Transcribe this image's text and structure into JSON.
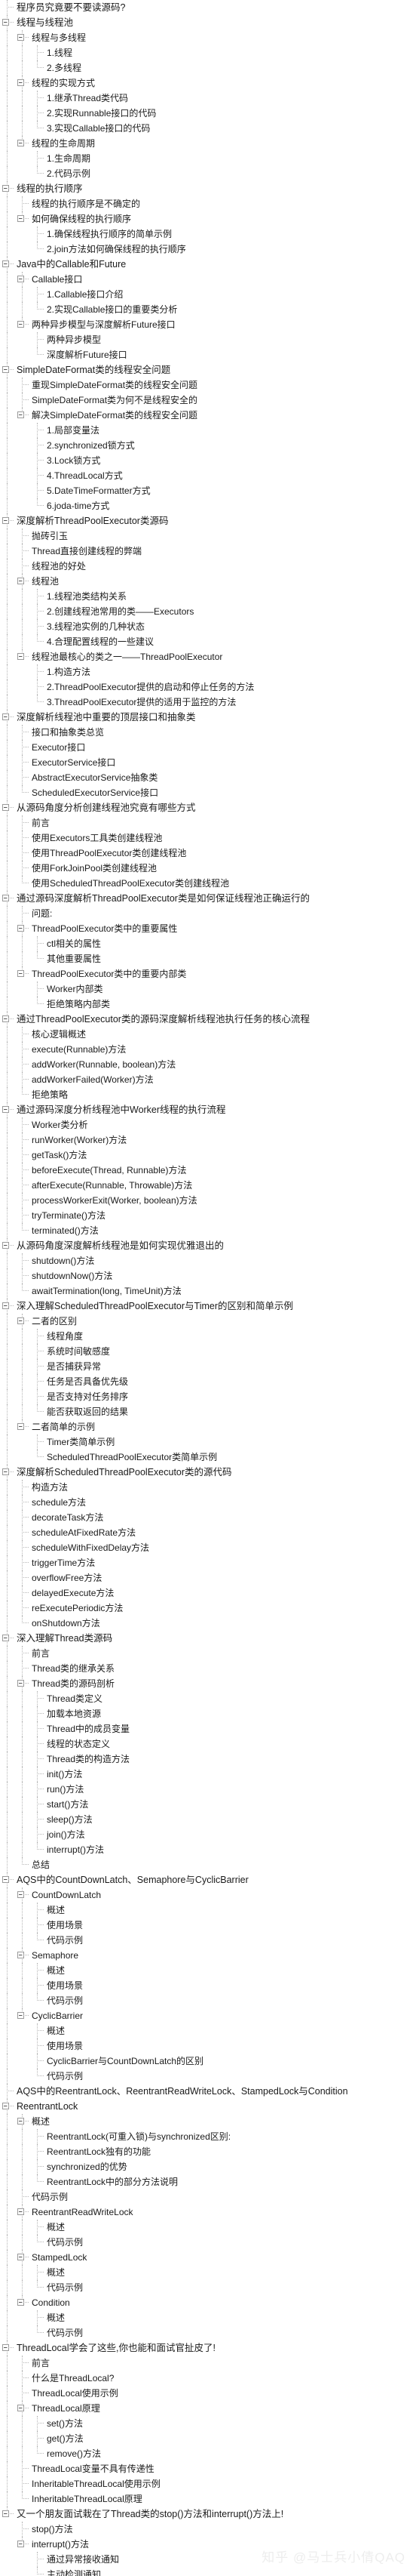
{
  "view": {
    "type": "outline-tree",
    "expander_collapse_glyph": "minus-box",
    "watermark": "知乎 @马士兵小倩QAQ",
    "colors": {
      "text": "#1a1a1a",
      "guide_line": "#b6b6b6",
      "expander_border": "#9a9a9a",
      "background": "#ffffff",
      "watermark": "#ededed"
    }
  },
  "nodes": [
    {
      "level": 0,
      "expandable": false,
      "label": "程序员究竟要不要读源码?"
    },
    {
      "level": 0,
      "expandable": true,
      "label": "线程与线程池"
    },
    {
      "level": 1,
      "expandable": true,
      "label": "线程与多线程"
    },
    {
      "level": 2,
      "expandable": false,
      "label": "1.线程"
    },
    {
      "level": 2,
      "expandable": false,
      "label": "2.多线程"
    },
    {
      "level": 1,
      "expandable": true,
      "label": "线程的实现方式"
    },
    {
      "level": 2,
      "expandable": false,
      "label": "1.继承Thread类代码"
    },
    {
      "level": 2,
      "expandable": false,
      "label": "2.实现Runnable接口的代码"
    },
    {
      "level": 2,
      "expandable": false,
      "label": "3.实现Callable接口的代码"
    },
    {
      "level": 1,
      "expandable": true,
      "label": "线程的生命周期"
    },
    {
      "level": 2,
      "expandable": false,
      "label": "1.生命周期"
    },
    {
      "level": 2,
      "expandable": false,
      "label": "2.代码示例"
    },
    {
      "level": 0,
      "expandable": true,
      "label": "线程的执行顺序"
    },
    {
      "level": 1,
      "expandable": false,
      "label": "线程的执行顺序是不确定的"
    },
    {
      "level": 1,
      "expandable": true,
      "label": "如何确保线程的执行顺序"
    },
    {
      "level": 2,
      "expandable": false,
      "label": "1.确保线程执行顺序的简单示例"
    },
    {
      "level": 2,
      "expandable": false,
      "label": "2.join方法如何确保线程的执行顺序"
    },
    {
      "level": 0,
      "expandable": true,
      "label": "Java中的Callable和Future"
    },
    {
      "level": 1,
      "expandable": true,
      "label": "Callable接口"
    },
    {
      "level": 2,
      "expandable": false,
      "label": "1.Callable接口介绍"
    },
    {
      "level": 2,
      "expandable": false,
      "label": "2.实现Callable接口的重要类分析"
    },
    {
      "level": 1,
      "expandable": true,
      "label": "两种异步模型与深度解析Future接口"
    },
    {
      "level": 2,
      "expandable": false,
      "label": "两种异步模型"
    },
    {
      "level": 2,
      "expandable": false,
      "label": "深度解析Future接口"
    },
    {
      "level": 0,
      "expandable": true,
      "label": "SimpleDateFormat类的线程安全问题"
    },
    {
      "level": 1,
      "expandable": false,
      "label": "重现SimpleDateFormat类的线程安全问题"
    },
    {
      "level": 1,
      "expandable": false,
      "label": "SimpleDateFormat类为何不是线程安全的"
    },
    {
      "level": 1,
      "expandable": true,
      "label": "解决SimpleDateFormat类的线程安全问题"
    },
    {
      "level": 2,
      "expandable": false,
      "label": "1.局部变量法"
    },
    {
      "level": 2,
      "expandable": false,
      "label": "2.synchronized锁方式"
    },
    {
      "level": 2,
      "expandable": false,
      "label": "3.Lock锁方式"
    },
    {
      "level": 2,
      "expandable": false,
      "label": "4.ThreadLocal方式"
    },
    {
      "level": 2,
      "expandable": false,
      "label": "5.DateTimeFormatter方式"
    },
    {
      "level": 2,
      "expandable": false,
      "label": "6.joda-time方式"
    },
    {
      "level": 0,
      "expandable": true,
      "label": "深度解析ThreadPoolExecutor类源码"
    },
    {
      "level": 1,
      "expandable": false,
      "label": "抛砖引玉"
    },
    {
      "level": 1,
      "expandable": false,
      "label": "Thread直接创建线程的弊端"
    },
    {
      "level": 1,
      "expandable": false,
      "label": "线程池的好处"
    },
    {
      "level": 1,
      "expandable": true,
      "label": "线程池"
    },
    {
      "level": 2,
      "expandable": false,
      "label": "1.线程池类结构关系"
    },
    {
      "level": 2,
      "expandable": false,
      "label": "2.创建线程池常用的类——Executors"
    },
    {
      "level": 2,
      "expandable": false,
      "label": "3.线程池实例的几种状态"
    },
    {
      "level": 2,
      "expandable": false,
      "label": "4.合理配置线程的一些建议"
    },
    {
      "level": 1,
      "expandable": true,
      "label": "线程池最核心的类之一——ThreadPoolExecutor"
    },
    {
      "level": 2,
      "expandable": false,
      "label": "1.构造方法"
    },
    {
      "level": 2,
      "expandable": false,
      "label": "2.ThreadPoolExecutor提供的启动和停止任务的方法"
    },
    {
      "level": 2,
      "expandable": false,
      "label": "3.ThreadPoolExecutor提供的适用于监控的方法"
    },
    {
      "level": 0,
      "expandable": true,
      "label": "深度解析线程池中重要的顶层接口和抽象类"
    },
    {
      "level": 1,
      "expandable": false,
      "label": "接口和抽象类总览"
    },
    {
      "level": 1,
      "expandable": false,
      "label": "Executor接口"
    },
    {
      "level": 1,
      "expandable": false,
      "label": "ExecutorService接口"
    },
    {
      "level": 1,
      "expandable": false,
      "label": "AbstractExecutorService抽象类"
    },
    {
      "level": 1,
      "expandable": false,
      "label": "ScheduledExecutorService接口"
    },
    {
      "level": 0,
      "expandable": true,
      "label": "从源码角度分析创建线程池究竟有哪些方式"
    },
    {
      "level": 1,
      "expandable": false,
      "label": "前言"
    },
    {
      "level": 1,
      "expandable": false,
      "label": "使用Executors工具类创建线程池"
    },
    {
      "level": 1,
      "expandable": false,
      "label": "使用ThreadPoolExecutor类创建线程池"
    },
    {
      "level": 1,
      "expandable": false,
      "label": "使用ForkJoinPool类创建线程池"
    },
    {
      "level": 1,
      "expandable": false,
      "label": "使用ScheduledThreadPoolExecutor类创建线程池"
    },
    {
      "level": 0,
      "expandable": true,
      "label": "通过源码深度解析ThreadPoolExecutor类是如何保证线程池正确运行的"
    },
    {
      "level": 1,
      "expandable": false,
      "label": "问题:"
    },
    {
      "level": 1,
      "expandable": true,
      "label": "ThreadPoolExecutor类中的重要属性"
    },
    {
      "level": 2,
      "expandable": false,
      "label": "ctl相关的属性"
    },
    {
      "level": 2,
      "expandable": false,
      "label": "其他重要属性"
    },
    {
      "level": 1,
      "expandable": true,
      "label": "ThreadPoolExecutor类中的重要内部类"
    },
    {
      "level": 2,
      "expandable": false,
      "label": "Worker内部类"
    },
    {
      "level": 2,
      "expandable": false,
      "label": "拒绝策略内部类"
    },
    {
      "level": 0,
      "expandable": true,
      "label": "通过ThreadPoolExecutor类的源码深度解析线程池执行任务的核心流程"
    },
    {
      "level": 1,
      "expandable": false,
      "label": "核心逻辑概述"
    },
    {
      "level": 1,
      "expandable": false,
      "label": "execute(Runnable)方法"
    },
    {
      "level": 1,
      "expandable": false,
      "label": "addWorker(Runnable, boolean)方法"
    },
    {
      "level": 1,
      "expandable": false,
      "label": "addWorkerFailed(Worker)方法"
    },
    {
      "level": 1,
      "expandable": false,
      "label": "拒绝策略"
    },
    {
      "level": 0,
      "expandable": true,
      "label": "通过源码深度分析线程池中Worker线程的执行流程"
    },
    {
      "level": 1,
      "expandable": false,
      "label": "Worker类分析"
    },
    {
      "level": 1,
      "expandable": false,
      "label": "runWorker(Worker)方法"
    },
    {
      "level": 1,
      "expandable": false,
      "label": "getTask()方法"
    },
    {
      "level": 1,
      "expandable": false,
      "label": "beforeExecute(Thread, Runnable)方法"
    },
    {
      "level": 1,
      "expandable": false,
      "label": "afterExecute(Runnable, Throwable)方法"
    },
    {
      "level": 1,
      "expandable": false,
      "label": "processWorkerExit(Worker, boolean)方法"
    },
    {
      "level": 1,
      "expandable": false,
      "label": "tryTerminate()方法"
    },
    {
      "level": 1,
      "expandable": false,
      "label": "terminated()方法"
    },
    {
      "level": 0,
      "expandable": true,
      "label": "从源码角度深度解析线程池是如何实现优雅退出的"
    },
    {
      "level": 1,
      "expandable": false,
      "label": "shutdown()方法"
    },
    {
      "level": 1,
      "expandable": false,
      "label": "shutdownNow()方法"
    },
    {
      "level": 1,
      "expandable": false,
      "label": "awaitTermination(long, TimeUnit)方法"
    },
    {
      "level": 0,
      "expandable": true,
      "label": "深入理解ScheduledThreadPoolExecutor与Timer的区别和简单示例"
    },
    {
      "level": 1,
      "expandable": true,
      "label": "二者的区别"
    },
    {
      "level": 2,
      "expandable": false,
      "label": "线程角度"
    },
    {
      "level": 2,
      "expandable": false,
      "label": "系统时间敏感度"
    },
    {
      "level": 2,
      "expandable": false,
      "label": "是否捕获异常"
    },
    {
      "level": 2,
      "expandable": false,
      "label": "任务是否具备优先级"
    },
    {
      "level": 2,
      "expandable": false,
      "label": "是否支持对任务排序"
    },
    {
      "level": 2,
      "expandable": false,
      "label": "能否获取返回的结果"
    },
    {
      "level": 1,
      "expandable": true,
      "label": "二者简单的示例"
    },
    {
      "level": 2,
      "expandable": false,
      "label": "Timer类简单示例"
    },
    {
      "level": 2,
      "expandable": false,
      "label": "ScheduledThreadPoolExecutor类简单示例"
    },
    {
      "level": 0,
      "expandable": true,
      "label": "深度解析ScheduledThreadPoolExecutor类的源代码"
    },
    {
      "level": 1,
      "expandable": false,
      "label": "构造方法"
    },
    {
      "level": 1,
      "expandable": false,
      "label": "schedule方法"
    },
    {
      "level": 1,
      "expandable": false,
      "label": "decorateTask方法"
    },
    {
      "level": 1,
      "expandable": false,
      "label": "scheduleAtFixedRate方法"
    },
    {
      "level": 1,
      "expandable": false,
      "label": "scheduleWithFixedDelay方法"
    },
    {
      "level": 1,
      "expandable": false,
      "label": "triggerTime方法"
    },
    {
      "level": 1,
      "expandable": false,
      "label": "overflowFree方法"
    },
    {
      "level": 1,
      "expandable": false,
      "label": "delayedExecute方法"
    },
    {
      "level": 1,
      "expandable": false,
      "label": "reExecutePeriodic方法"
    },
    {
      "level": 1,
      "expandable": false,
      "label": "onShutdown方法"
    },
    {
      "level": 0,
      "expandable": true,
      "label": "深入理解Thread类源码"
    },
    {
      "level": 1,
      "expandable": false,
      "label": "前言"
    },
    {
      "level": 1,
      "expandable": false,
      "label": "Thread类的继承关系"
    },
    {
      "level": 1,
      "expandable": true,
      "label": "Thread类的源码剖析"
    },
    {
      "level": 2,
      "expandable": false,
      "label": "Thread类定义"
    },
    {
      "level": 2,
      "expandable": false,
      "label": "加载本地资源"
    },
    {
      "level": 2,
      "expandable": false,
      "label": "Thread中的成员变量"
    },
    {
      "level": 2,
      "expandable": false,
      "label": "线程的状态定义"
    },
    {
      "level": 2,
      "expandable": false,
      "label": "Thread类的构造方法"
    },
    {
      "level": 2,
      "expandable": false,
      "label": "init()方法"
    },
    {
      "level": 2,
      "expandable": false,
      "label": "run()方法"
    },
    {
      "level": 2,
      "expandable": false,
      "label": "start()方法"
    },
    {
      "level": 2,
      "expandable": false,
      "label": "sleep()方法"
    },
    {
      "level": 2,
      "expandable": false,
      "label": "join()方法"
    },
    {
      "level": 2,
      "expandable": false,
      "label": "interrupt()方法"
    },
    {
      "level": 1,
      "expandable": false,
      "label": "总结"
    },
    {
      "level": 0,
      "expandable": true,
      "label": "AQS中的CountDownLatch、Semaphore与CyclicBarrier"
    },
    {
      "level": 1,
      "expandable": true,
      "label": "CountDownLatch"
    },
    {
      "level": 2,
      "expandable": false,
      "label": "概述"
    },
    {
      "level": 2,
      "expandable": false,
      "label": "使用场景"
    },
    {
      "level": 2,
      "expandable": false,
      "label": "代码示例"
    },
    {
      "level": 1,
      "expandable": true,
      "label": "Semaphore"
    },
    {
      "level": 2,
      "expandable": false,
      "label": "概述"
    },
    {
      "level": 2,
      "expandable": false,
      "label": "使用场景"
    },
    {
      "level": 2,
      "expandable": false,
      "label": "代码示例"
    },
    {
      "level": 1,
      "expandable": true,
      "label": "CyclicBarrier"
    },
    {
      "level": 2,
      "expandable": false,
      "label": "概述"
    },
    {
      "level": 2,
      "expandable": false,
      "label": "使用场景"
    },
    {
      "level": 2,
      "expandable": false,
      "label": "CyclicBarrier与CountDownLatch的区别"
    },
    {
      "level": 2,
      "expandable": false,
      "label": "代码示例"
    },
    {
      "level": 0,
      "expandable": false,
      "label": "AQS中的ReentrantLock、ReentrantReadWriteLock、StampedLock与Condition"
    },
    {
      "level": 0,
      "expandable": true,
      "label": "ReentrantLock"
    },
    {
      "level": 1,
      "expandable": true,
      "label": "概述"
    },
    {
      "level": 2,
      "expandable": false,
      "label": "ReentrantLock(可重入锁)与synchronized区别:"
    },
    {
      "level": 2,
      "expandable": false,
      "label": "ReentrantLock独有的功能"
    },
    {
      "level": 2,
      "expandable": false,
      "label": "synchronized的优势"
    },
    {
      "level": 2,
      "expandable": false,
      "label": "ReentrantLock中的部分方法说明"
    },
    {
      "level": 1,
      "expandable": false,
      "label": "代码示例"
    },
    {
      "level": 1,
      "expandable": true,
      "label": "ReentrantReadWriteLock"
    },
    {
      "level": 2,
      "expandable": false,
      "label": "概述"
    },
    {
      "level": 2,
      "expandable": false,
      "label": "代码示例"
    },
    {
      "level": 1,
      "expandable": true,
      "label": "StampedLock"
    },
    {
      "level": 2,
      "expandable": false,
      "label": "概述"
    },
    {
      "level": 2,
      "expandable": false,
      "label": "代码示例"
    },
    {
      "level": 1,
      "expandable": true,
      "label": "Condition"
    },
    {
      "level": 2,
      "expandable": false,
      "label": "概述"
    },
    {
      "level": 2,
      "expandable": false,
      "label": "代码示例"
    },
    {
      "level": 0,
      "expandable": true,
      "label": "ThreadLocal学会了这些,你也能和面试官扯皮了!"
    },
    {
      "level": 1,
      "expandable": false,
      "label": "前言"
    },
    {
      "level": 1,
      "expandable": false,
      "label": "什么是ThreadLocal?"
    },
    {
      "level": 1,
      "expandable": false,
      "label": "ThreadLocal使用示例"
    },
    {
      "level": 1,
      "expandable": true,
      "label": "ThreadLocal原理"
    },
    {
      "level": 2,
      "expandable": false,
      "label": "set()方法"
    },
    {
      "level": 2,
      "expandable": false,
      "label": "get()方法"
    },
    {
      "level": 2,
      "expandable": false,
      "label": "remove()方法"
    },
    {
      "level": 1,
      "expandable": false,
      "label": "ThreadLocal变量不具有传递性"
    },
    {
      "level": 1,
      "expandable": false,
      "label": "InheritableThreadLocal使用示例"
    },
    {
      "level": 1,
      "expandable": false,
      "label": "InheritableThreadLocal原理"
    },
    {
      "level": 0,
      "expandable": true,
      "label": "又一个朋友面试栽在了Thread类的stop()方法和interrupt()方法上!"
    },
    {
      "level": 1,
      "expandable": false,
      "label": "stop()方法"
    },
    {
      "level": 1,
      "expandable": true,
      "label": "interrupt()方法"
    },
    {
      "level": 2,
      "expandable": false,
      "label": "通过异常接收通知"
    },
    {
      "level": 2,
      "expandable": false,
      "label": "主动检测通知"
    }
  ]
}
